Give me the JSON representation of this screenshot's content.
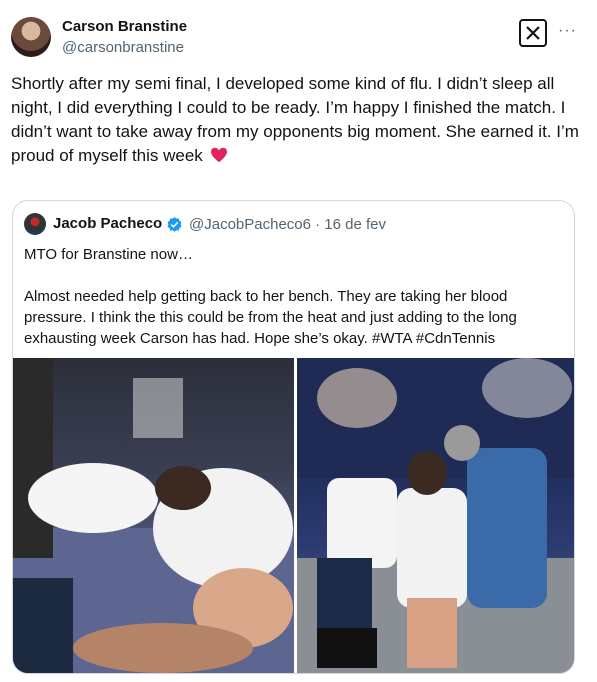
{
  "tweet": {
    "author_name": "Carson Branstine",
    "author_handle": "@carsonbranstine",
    "text": "Shortly after my semi final, I developed some kind of flu. I didn’t sleep all night, I did everything I could to be ready. I’m happy I finished the match. I didn’t want to take away from my opponents big moment. She earned it. I’m proud of myself this week",
    "emoji": "red-heart",
    "more_label": "···",
    "logo_label": "𝕏"
  },
  "quoted_tweet": {
    "author_name": "Jacob Pacheco",
    "author_handle_date": "@JacobPacheco6 · 16 de fev",
    "text": "MTO for Branstine now…\n\nAlmost needed help getting back to her bench. They are taking her blood pressure. I think the this could be from the heat and just adding to the long exhausting week Carson has had. Hope she’s okay. #WTA #CdnTennis",
    "photos": [
      "tennis-court-player-kneeling",
      "player-bench-medical-check"
    ]
  },
  "colors": {
    "text": "#0f1419",
    "muted": "#536471",
    "border": "#cfd9de",
    "verified": "#1d9bf0",
    "heart": "#e0245e"
  }
}
